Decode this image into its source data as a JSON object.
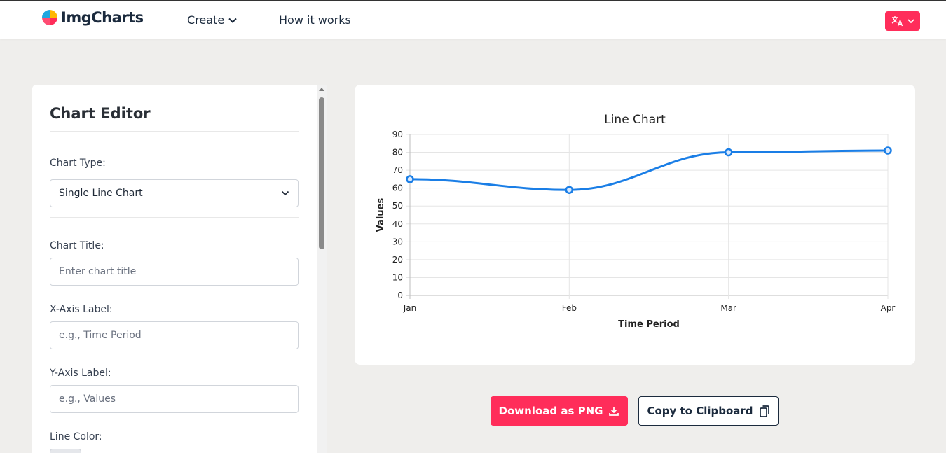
{
  "header": {
    "brand": "ImgCharts",
    "nav": {
      "create": "Create",
      "how_it_works": "How it works"
    },
    "accent_color": "#ff2d5a"
  },
  "editor": {
    "title": "Chart Editor",
    "chart_type": {
      "label": "Chart Type:",
      "value": "Single Line Chart"
    },
    "chart_title": {
      "label": "Chart Title:",
      "placeholder": "Enter chart title",
      "value": ""
    },
    "x_axis": {
      "label": "X-Axis Label:",
      "placeholder": "e.g., Time Period",
      "value": ""
    },
    "y_axis": {
      "label": "Y-Axis Label:",
      "placeholder": "e.g., Values",
      "value": ""
    },
    "line_color": {
      "label": "Line Color:"
    }
  },
  "chart_data": {
    "type": "line",
    "title": "Line Chart",
    "xlabel": "Time Period",
    "ylabel": "Values",
    "categories": [
      "Jan",
      "Feb",
      "Mar",
      "Apr"
    ],
    "series": [
      {
        "values": [
          65,
          59,
          80,
          81
        ]
      }
    ],
    "ylim": [
      0,
      90
    ],
    "yticks": [
      0,
      10,
      20,
      30,
      40,
      50,
      60,
      70,
      80,
      90
    ],
    "grid": true,
    "line_color": "#1a7ee6"
  },
  "actions": {
    "download": "Download as PNG",
    "copy": "Copy to Clipboard"
  }
}
